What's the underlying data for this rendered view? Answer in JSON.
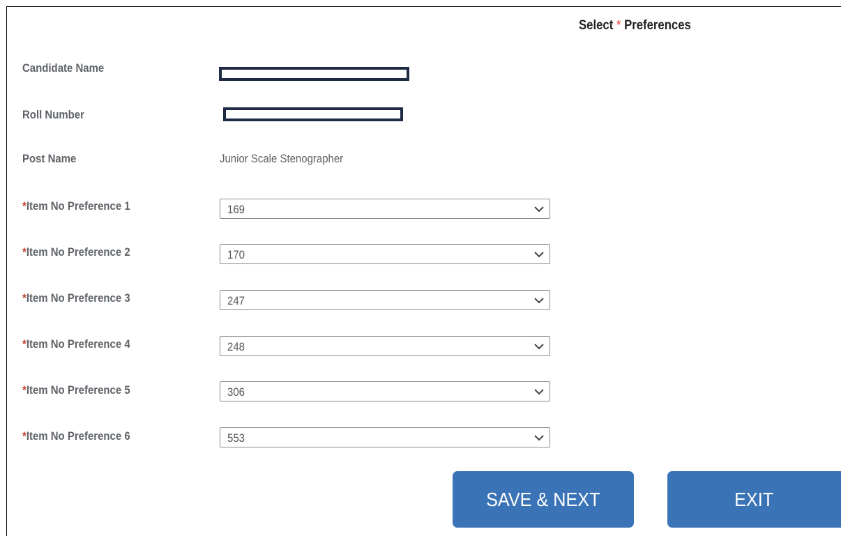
{
  "header": {
    "title_prefix": "Select",
    "title_required": "*",
    "title_suffix": "Preferences"
  },
  "candidate": {
    "name_label": "Candidate Name",
    "roll_label": "Roll Number",
    "post_label": "Post Name",
    "post_value": "Junior Scale Stenographer"
  },
  "preferences": [
    {
      "required": "*",
      "label": "Item No Preference 1",
      "value": "169"
    },
    {
      "required": "*",
      "label": "Item No Preference 2",
      "value": "170"
    },
    {
      "required": "*",
      "label": "Item No Preference 3",
      "value": "247"
    },
    {
      "required": "*",
      "label": "Item No Preference 4",
      "value": "248"
    },
    {
      "required": "*",
      "label": "Item No Preference 5",
      "value": "306"
    },
    {
      "required": "*",
      "label": "Item No Preference 6",
      "value": "553"
    }
  ],
  "actions": {
    "save_next_label": "SAVE & NEXT",
    "exit_label": "EXIT"
  },
  "colors": {
    "button_bg": "#3a73b6",
    "required_star": "#c0392b",
    "label_text": "#5f6368",
    "redaction_border": "#1f2a44"
  },
  "icons": {
    "dropdown": "chevron-down-icon"
  }
}
